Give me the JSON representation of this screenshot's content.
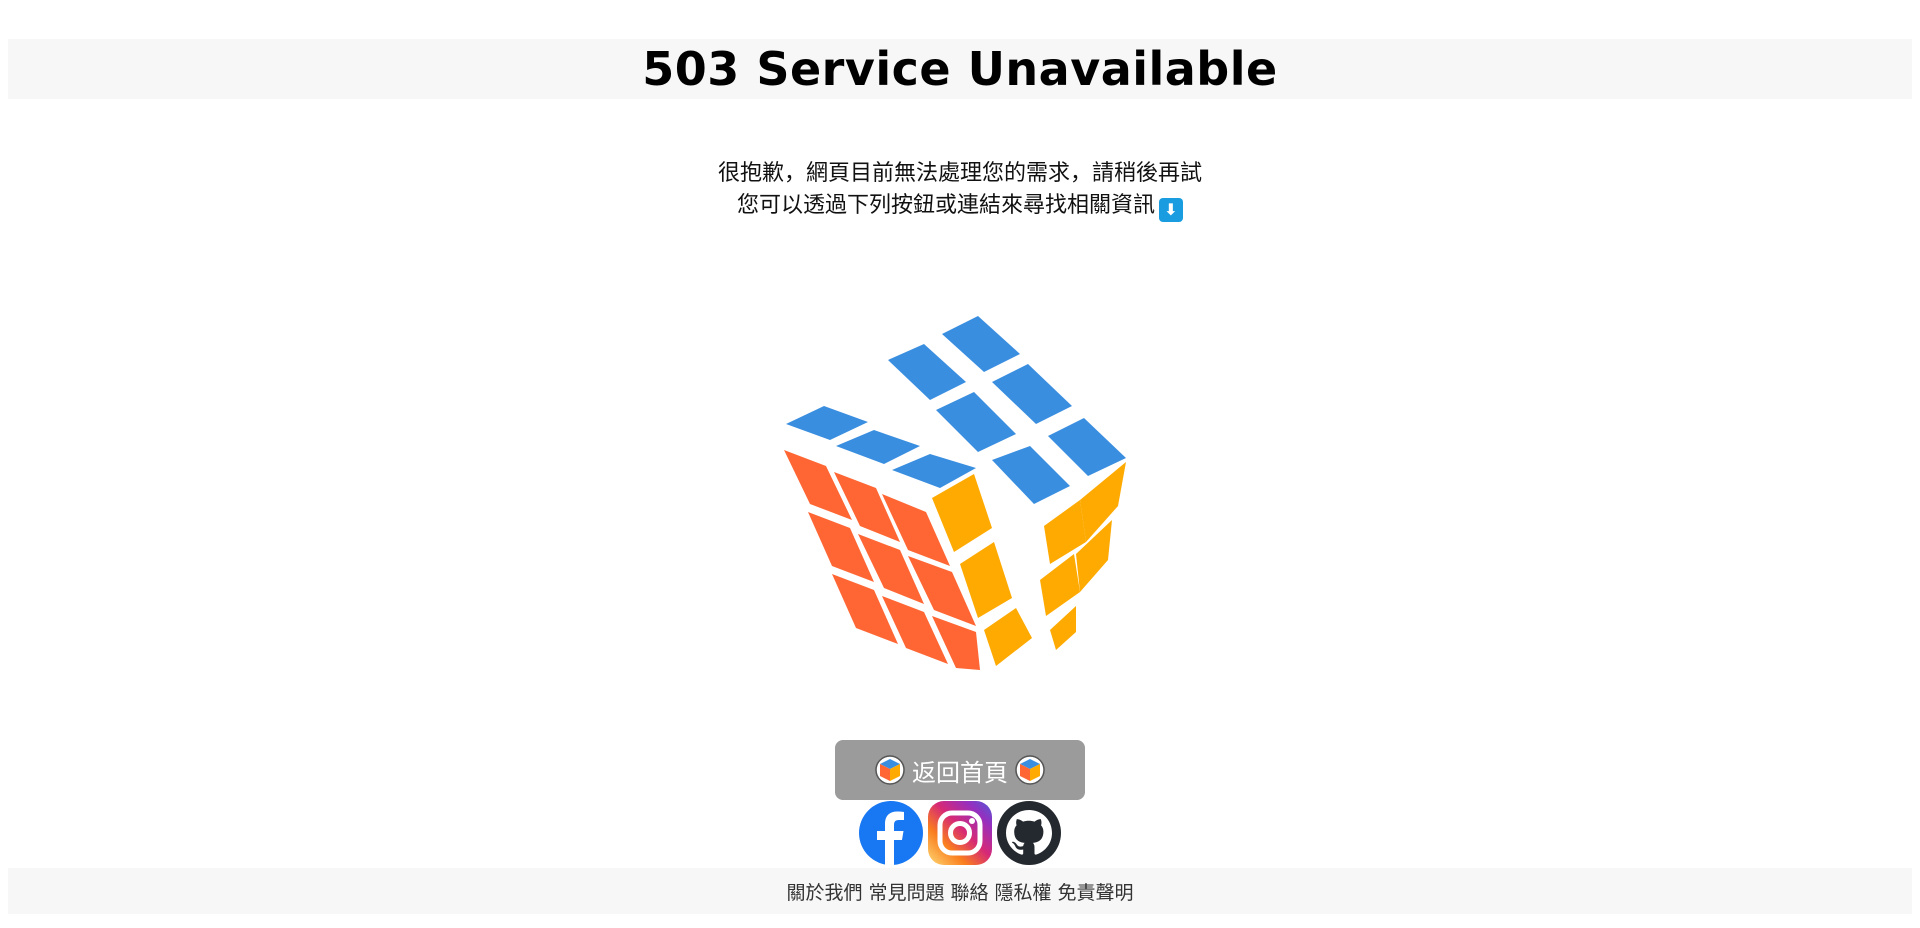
{
  "header": {
    "title": "503 Service Unavailable"
  },
  "message": {
    "line1": "很抱歉，網頁目前無法處理您的需求，請稍後再試",
    "line2": "您可以透過下列按鈕或連結來尋找相關資訊",
    "line2_icon": "down-arrow-icon"
  },
  "illustration": {
    "icon": "rubiks-cube-icon",
    "colors": {
      "top": "#3a8ee0",
      "left": "#ff6633",
      "right": "#ffaa00"
    }
  },
  "home_button": {
    "label": "返回首頁",
    "color": "#9b9b9b",
    "icon": "site-logo-icon"
  },
  "social": [
    {
      "name": "facebook-icon",
      "color": "#1877f2"
    },
    {
      "name": "instagram-icon",
      "color": "#e1306c"
    },
    {
      "name": "github-icon",
      "color": "#24292f"
    }
  ],
  "footer": {
    "links": [
      "關於我們",
      "常見問題",
      "聯絡",
      "隱私權",
      "免責聲明"
    ]
  }
}
